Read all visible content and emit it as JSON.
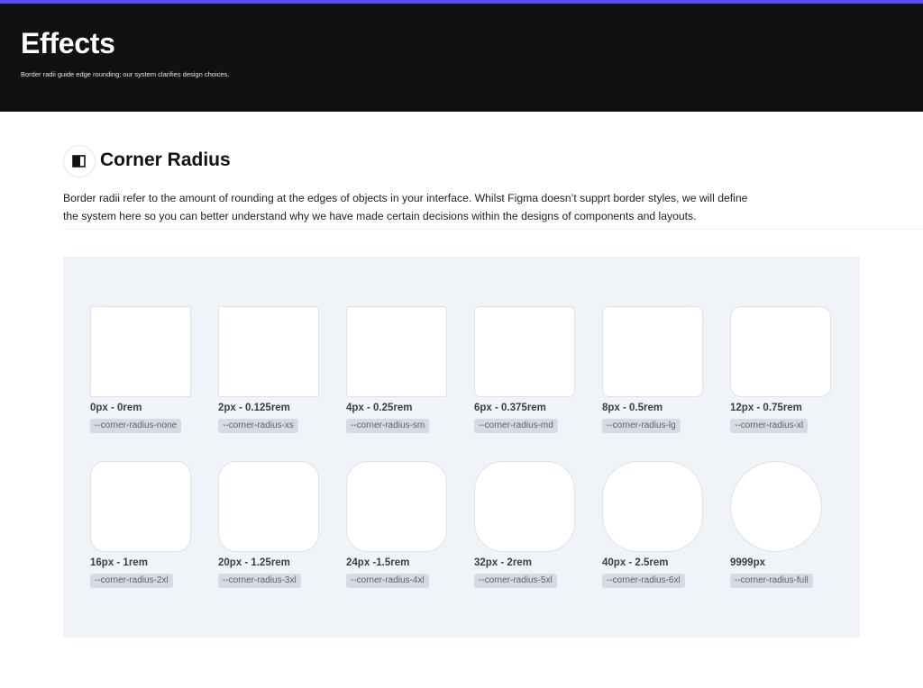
{
  "colors": {
    "accent": "#5b4cf2",
    "hero_bg": "#111111",
    "panel_bg": "#f0f3f7",
    "token_bg": "#d5dbe3"
  },
  "hero": {
    "title": "Effects",
    "subtitle": "Border radii guide edge rounding; our system clarifies design choices."
  },
  "section": {
    "icon": "corner-radius-icon",
    "title": "Corner Radius",
    "description": "Border radii refer to the amount of rounding at the edges of objects in your interface. Whilst Figma doesn’t supprt border styles, we will define the system here so you can better understand why we have made certain decisions within the designs of components and layouts."
  },
  "radii": [
    {
      "label": "0px - 0rem",
      "token": "--corner-radius-none",
      "radius_px": 0
    },
    {
      "label": "2px - 0.125rem",
      "token": "--corner-radius-xs",
      "radius_px": 2
    },
    {
      "label": "4px - 0.25rem",
      "token": "--corner-radius-sm",
      "radius_px": 4
    },
    {
      "label": "6px - 0.375rem",
      "token": "--corner-radius-md",
      "radius_px": 6
    },
    {
      "label": "8px - 0.5rem",
      "token": "--corner-radius-lg",
      "radius_px": 8
    },
    {
      "label": "12px - 0.75rem",
      "token": "--corner-radius-xl",
      "radius_px": 12
    },
    {
      "label": "16px - 1rem",
      "token": "--corner-radius-2xl",
      "radius_px": 16
    },
    {
      "label": "20px - 1.25rem",
      "token": "--corner-radius-3xl",
      "radius_px": 20
    },
    {
      "label": "24px -1.5rem",
      "token": "--corner-radius-4xl",
      "radius_px": 24
    },
    {
      "label": "32px - 2rem",
      "token": "--corner-radius-5xl",
      "radius_px": 32
    },
    {
      "label": "40px - 2.5rem",
      "token": "--corner-radius-6xl",
      "radius_px": 40
    },
    {
      "label": "9999px",
      "token": "--corner-radius-full",
      "radius_px": 9999
    }
  ]
}
